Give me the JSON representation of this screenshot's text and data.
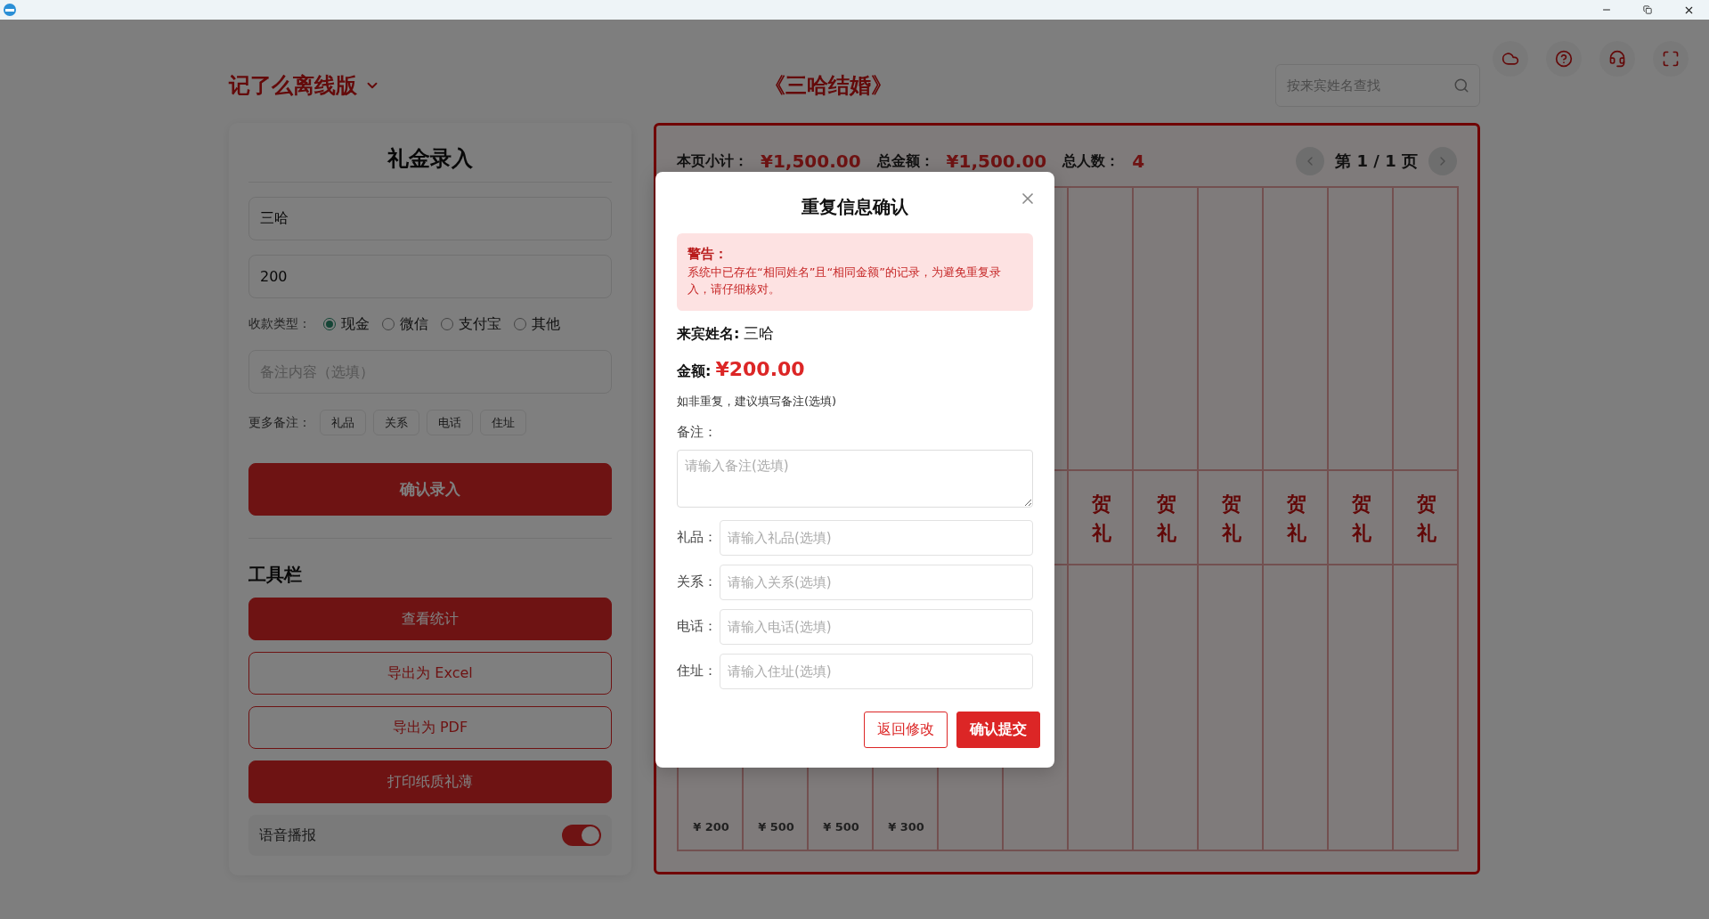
{
  "header": {
    "brand": "记了么离线版",
    "title": "《三哈结婚》",
    "search": {
      "placeholder": "按来宾姓名查找"
    }
  },
  "entry_form": {
    "title": "礼金录入",
    "name_value": "三哈",
    "amount_value": "200",
    "payment_label": "收款类型：",
    "payment_options": [
      {
        "label": "现金",
        "selected": true
      },
      {
        "label": "微信",
        "selected": false
      },
      {
        "label": "支付宝",
        "selected": false
      },
      {
        "label": "其他",
        "selected": false
      }
    ],
    "note_placeholder": "备注内容（选填）",
    "more_label": "更多备注：",
    "more_tags": [
      "礼品",
      "关系",
      "电话",
      "住址"
    ],
    "submit": "确认录入"
  },
  "toolbar": {
    "title": "工具栏",
    "buttons": [
      {
        "label": "查看统计",
        "kind": "primary"
      },
      {
        "label": "导出为 Excel",
        "kind": "outline"
      },
      {
        "label": "导出为 PDF",
        "kind": "outline"
      },
      {
        "label": "打印纸质礼薄",
        "kind": "primary"
      }
    ],
    "voice": {
      "label": "语音播报",
      "on": true
    }
  },
  "book": {
    "summary": [
      {
        "label": "本页小计：",
        "value": "¥1,500.00"
      },
      {
        "label": "总金额：",
        "value": "¥1,500.00"
      },
      {
        "label": "总人数：",
        "value": "4"
      }
    ],
    "pagination": "第 1 / 1 页",
    "columns": [
      {
        "kind": "amount",
        "amount": "¥ 200"
      },
      {
        "kind": "amount",
        "amount": "¥ 500"
      },
      {
        "kind": "amount",
        "amount": "¥ 500"
      },
      {
        "kind": "amount",
        "amount": "¥ 300"
      },
      {
        "kind": "blank"
      },
      {
        "kind": "blank"
      },
      {
        "kind": "gift",
        "label": "贺礼"
      },
      {
        "kind": "gift",
        "label": "贺礼"
      },
      {
        "kind": "gift",
        "label": "贺礼"
      },
      {
        "kind": "gift",
        "label": "贺礼"
      },
      {
        "kind": "gift",
        "label": "贺礼"
      },
      {
        "kind": "gift",
        "label": "贺礼"
      }
    ]
  },
  "dialog": {
    "title": "重复信息确认",
    "warning_title": "警告：",
    "warning_text": "系统中已存在“相同姓名”且“相同金额”的记录，为避免重复录入，请仔细核对。",
    "name_label": "来宾姓名:",
    "name_value": "三哈",
    "amount_label": "金额:",
    "amount_value": "¥200.00",
    "hint": "如非重复，建议填写备注(选填)",
    "note_label": "备注：",
    "note_placeholder": "请输入备注(选填)",
    "fields": [
      {
        "label": "礼品：",
        "placeholder": "请输入礼品(选填)"
      },
      {
        "label": "关系：",
        "placeholder": "请输入关系(选填)"
      },
      {
        "label": "电话：",
        "placeholder": "请输入电话(选填)"
      },
      {
        "label": "住址：",
        "placeholder": "请输入住址(选填)"
      }
    ],
    "buttons": [
      {
        "label": "返回修改",
        "kind": "outline"
      },
      {
        "label": "确认提交",
        "kind": "primary"
      }
    ]
  }
}
